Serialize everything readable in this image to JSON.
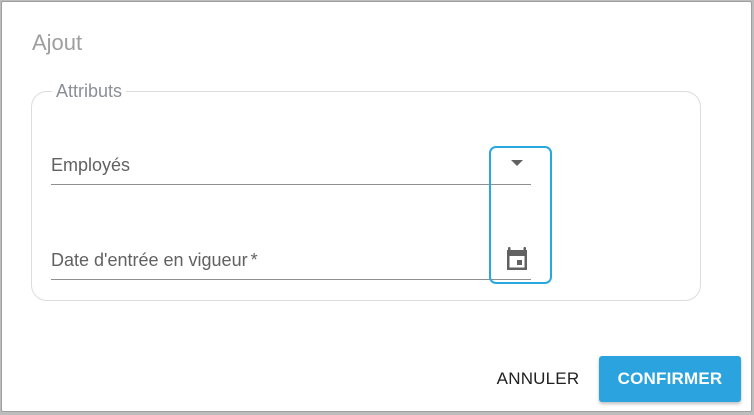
{
  "dialog": {
    "title": "Ajout"
  },
  "attributes": {
    "legend": "Attributs",
    "employees_field": {
      "label": "Employés",
      "icon": "dropdown-arrow-icon"
    },
    "effective_date_field": {
      "label": "Date d'entrée en vigueur",
      "required_marker": "*",
      "icon": "calendar-icon"
    }
  },
  "actions": {
    "cancel_label": "ANNULER",
    "confirm_label": "CONFIRMER"
  },
  "colors": {
    "accent": "#2ba3de",
    "focus_ring": "#29a8e0",
    "title": "#9e9e9e",
    "legend": "#8a8f96",
    "icon": "#616161"
  }
}
